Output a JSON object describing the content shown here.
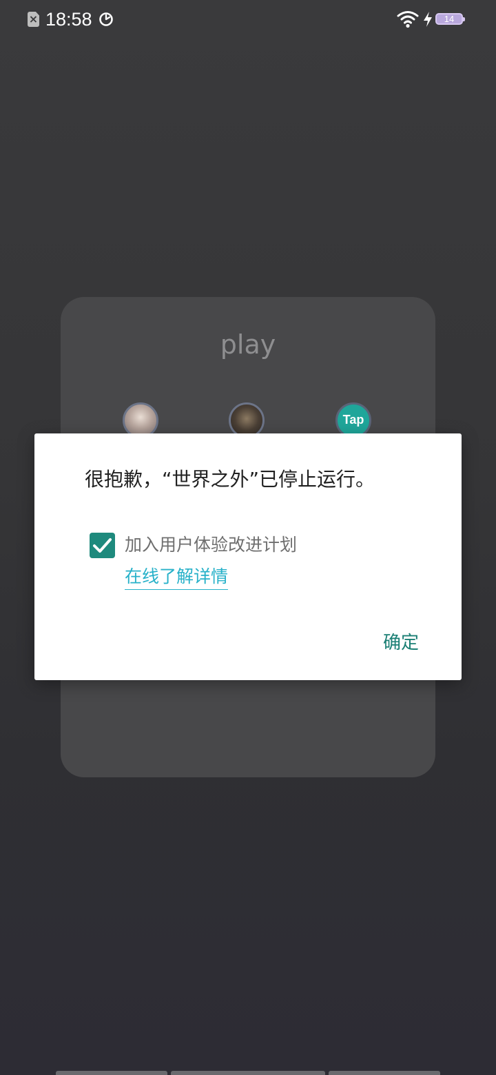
{
  "status_bar": {
    "time": "18:58",
    "battery_level": "14",
    "icons": [
      "sim-missing-icon",
      "sync-icon",
      "wifi-icon",
      "charging-bolt-icon",
      "battery-icon"
    ]
  },
  "background_widget": {
    "title": "play",
    "apps": [
      {
        "icon": "app-avatar-icon-1"
      },
      {
        "icon": "app-avatar-icon-2"
      },
      {
        "icon": "taptap-icon",
        "label": "Tap"
      }
    ]
  },
  "dialog": {
    "message": "很抱歉，“世界之外”已停止运行。",
    "checkbox": {
      "label": "加入用户体验改进计划",
      "checked": true
    },
    "link": "在线了解详情",
    "ok_button": "确定"
  },
  "colors": {
    "accent": "#1e8a7d",
    "link": "#27b1c9",
    "button_text": "#1a7f74",
    "dialog_background": "#ffffff",
    "screen_background": "#3a3a3c"
  }
}
